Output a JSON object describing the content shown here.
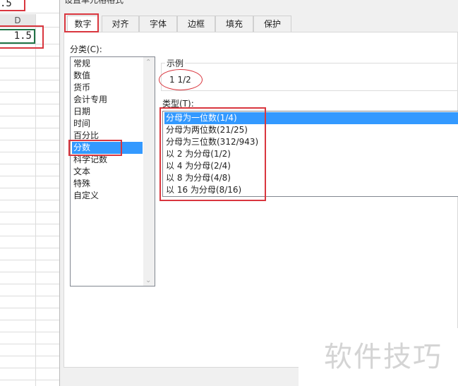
{
  "sheet": {
    "cell_top": ".5",
    "column_header": "D",
    "cell_value": "1.5"
  },
  "dialog": {
    "title": "设置单元格格式",
    "tabs": [
      {
        "label": "数字"
      },
      {
        "label": "对齐"
      },
      {
        "label": "字体"
      },
      {
        "label": "边框"
      },
      {
        "label": "填充"
      },
      {
        "label": "保护"
      }
    ],
    "category_label": "分类(C):",
    "categories": [
      "常规",
      "数值",
      "货币",
      "会计专用",
      "日期",
      "时间",
      "百分比",
      "分数",
      "科学记数",
      "文本",
      "特殊",
      "自定义"
    ],
    "selected_category": "分数",
    "sample_label": "示例",
    "sample_value": "1 1/2",
    "type_label": "类型(T):",
    "types": [
      "分母为一位数(1/4)",
      "分母为两位数(21/25)",
      "分母为三位数(312/943)",
      "以 2 为分母(1/2)",
      "以 4 为分母(2/4)",
      "以 8 为分母(4/8)",
      "以 16 为分母(8/16)"
    ],
    "selected_type": "分母为一位数(1/4)"
  },
  "watermark": "软件技巧",
  "colors": {
    "highlight": "#d9363e",
    "selection": "#3399ff",
    "cell_border": "#217346"
  }
}
